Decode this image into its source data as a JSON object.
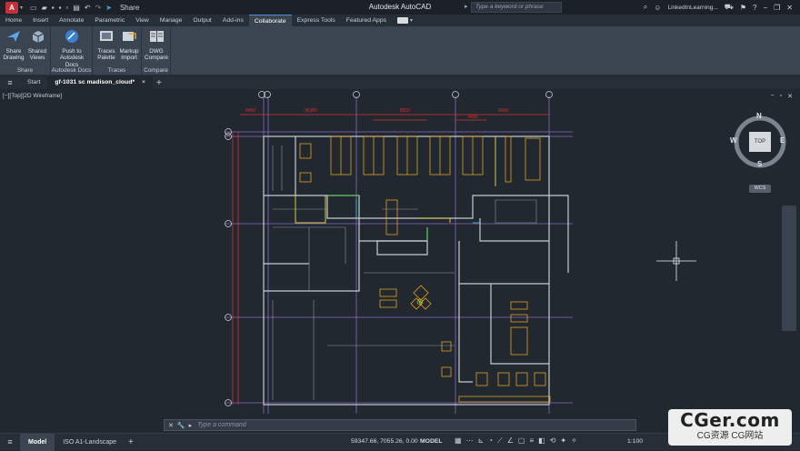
{
  "titlebar": {
    "app_letter": "A",
    "share": "Share",
    "title": "Autodesk AutoCAD",
    "search_placeholder": "Type a keyword or phrase",
    "user": "LinkedInLearning..."
  },
  "ribbon_tabs": [
    "Home",
    "Insert",
    "Annotate",
    "Parametric",
    "View",
    "Manage",
    "Output",
    "Add-ins",
    "Collaborate",
    "Express Tools",
    "Featured Apps"
  ],
  "active_ribbon_tab": "Collaborate",
  "ribbon": {
    "panels": [
      {
        "title": "Share",
        "buttons": [
          {
            "line1": "Share",
            "line2": "Drawing",
            "icon": "share-drawing-icon"
          },
          {
            "line1": "Shared",
            "line2": "Views",
            "icon": "shared-views-icon"
          }
        ]
      },
      {
        "title": "Autodesk Docs",
        "buttons": [
          {
            "line1": "Push to",
            "line2": "Autodesk Docs",
            "icon": "autodesk-docs-icon"
          }
        ]
      },
      {
        "title": "Traces",
        "buttons": [
          {
            "line1": "Traces",
            "line2": "Palette",
            "icon": "traces-palette-icon"
          },
          {
            "line1": "Markup",
            "line2": "Import",
            "icon": "markup-import-icon"
          }
        ]
      },
      {
        "title": "Compare",
        "buttons": [
          {
            "line1": "DWG",
            "line2": "Compare",
            "icon": "dwg-compare-icon"
          }
        ]
      }
    ]
  },
  "file_tabs": {
    "start": "Start",
    "active": "gf-1031 sc madison_cloud*",
    "close": "×",
    "add": "+"
  },
  "viewport": {
    "label": "[−][Top][2D Wireframe]",
    "viewcube": {
      "face": "TOP",
      "n": "N",
      "s": "S",
      "e": "E",
      "w": "W",
      "wcs": "WCS"
    },
    "grid_bubbles": [
      "D",
      "C",
      "B",
      "A",
      "5",
      "4",
      "3",
      "2",
      "1"
    ],
    "dims": [
      "4450",
      "36300",
      "8510",
      "4000",
      "4000"
    ]
  },
  "command_line": {
    "placeholder": "Type a command"
  },
  "statusbar": {
    "layout_tabs": [
      "Model",
      "ISO A1-Landscape"
    ],
    "active_tab": "Model",
    "coords": "59347.66, 7055.26, 0.00",
    "mode": "MODEL",
    "scale": "1:100"
  },
  "watermark": {
    "main": "CGer.com",
    "sub": "CG资源 CG网站"
  },
  "colors": {
    "wall": "#c8ccd2",
    "furniture": "#e0a020",
    "grid": "#a878d8",
    "dims": "#e03030",
    "green": "#50d050",
    "cyan": "#3cc8d8"
  }
}
